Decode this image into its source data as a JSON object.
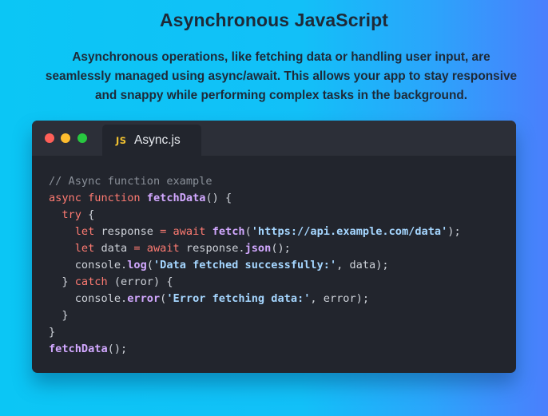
{
  "header": {
    "title": "Asynchronous JavaScript",
    "description": "Asynchronous operations, like fetching data or handling user input, are seamlessly managed using async/await. This allows your app to stay responsive and snappy while performing complex tasks in the background."
  },
  "editor": {
    "tab": {
      "badge": "JS",
      "filename": "Async.js"
    },
    "code_lines": [
      [
        {
          "t": "comment",
          "v": "// Async function example"
        }
      ],
      [
        {
          "t": "keyword",
          "v": "async"
        },
        {
          "t": "plain",
          "v": " "
        },
        {
          "t": "keyword",
          "v": "function"
        },
        {
          "t": "plain",
          "v": " "
        },
        {
          "t": "func",
          "v": "fetchData"
        },
        {
          "t": "plain",
          "v": "() {"
        }
      ],
      [
        {
          "t": "plain",
          "v": "  "
        },
        {
          "t": "keyword",
          "v": "try"
        },
        {
          "t": "plain",
          "v": " {"
        }
      ],
      [
        {
          "t": "plain",
          "v": "    "
        },
        {
          "t": "keyword",
          "v": "let"
        },
        {
          "t": "plain",
          "v": " response "
        },
        {
          "t": "keyword",
          "v": "="
        },
        {
          "t": "plain",
          "v": " "
        },
        {
          "t": "keyword",
          "v": "await"
        },
        {
          "t": "plain",
          "v": " "
        },
        {
          "t": "func",
          "v": "fetch"
        },
        {
          "t": "plain",
          "v": "("
        },
        {
          "t": "string",
          "v": "'https://api.example.com/data'"
        },
        {
          "t": "plain",
          "v": ");"
        }
      ],
      [
        {
          "t": "plain",
          "v": "    "
        },
        {
          "t": "keyword",
          "v": "let"
        },
        {
          "t": "plain",
          "v": " data "
        },
        {
          "t": "keyword",
          "v": "="
        },
        {
          "t": "plain",
          "v": " "
        },
        {
          "t": "keyword",
          "v": "await"
        },
        {
          "t": "plain",
          "v": " response."
        },
        {
          "t": "func",
          "v": "json"
        },
        {
          "t": "plain",
          "v": "();"
        }
      ],
      [
        {
          "t": "plain",
          "v": "    console."
        },
        {
          "t": "func",
          "v": "log"
        },
        {
          "t": "plain",
          "v": "("
        },
        {
          "t": "string",
          "v": "'Data fetched successfully:'"
        },
        {
          "t": "plain",
          "v": ", data);"
        }
      ],
      [
        {
          "t": "plain",
          "v": "  } "
        },
        {
          "t": "keyword",
          "v": "catch"
        },
        {
          "t": "plain",
          "v": " (error) {"
        }
      ],
      [
        {
          "t": "plain",
          "v": "    console."
        },
        {
          "t": "func",
          "v": "error"
        },
        {
          "t": "plain",
          "v": "("
        },
        {
          "t": "string",
          "v": "'Error fetching data:'"
        },
        {
          "t": "plain",
          "v": ", error);"
        }
      ],
      [
        {
          "t": "plain",
          "v": "  }"
        }
      ],
      [
        {
          "t": "plain",
          "v": "}"
        }
      ],
      [
        {
          "t": "func",
          "v": "fetchData"
        },
        {
          "t": "plain",
          "v": "();"
        }
      ]
    ]
  },
  "colors": {
    "background_start": "#0bc6f5",
    "background_end": "#4a7ffc",
    "editor_bg": "#22252d",
    "titlebar_bg": "#2c2f38",
    "keyword": "#ff7b72",
    "function": "#d2a8ff",
    "string": "#a5d6ff",
    "comment": "#8a9099",
    "js_badge": "#f2c230"
  }
}
